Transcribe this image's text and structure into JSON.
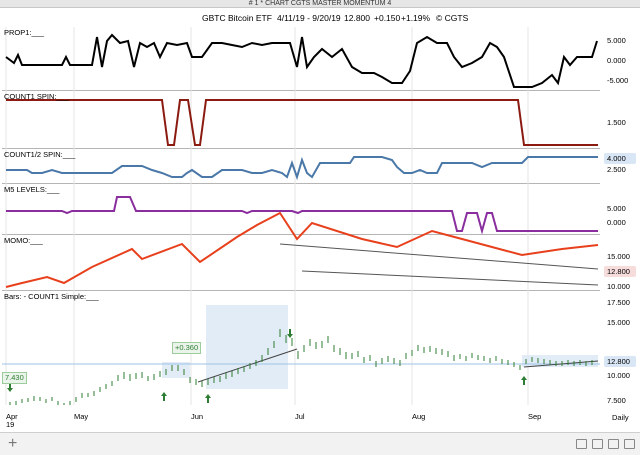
{
  "window": {
    "title": "# 1 * CHART CGTS MASTER MOMENTUM 4"
  },
  "header": {
    "symbol": "GBTC",
    "name": "Bitcoin ETF",
    "range": "4/11/19 - 9/20/19",
    "last": "12.800",
    "change": "+0.150",
    "pct": "+1.19%",
    "credit": "© CGTS"
  },
  "panels": {
    "prop1": {
      "label": "PROP1:___",
      "scale": [
        "5.000",
        "0.000",
        "-5.000"
      ]
    },
    "count1": {
      "label": "COUNT1 SPIN:___",
      "scale": [
        "1.500"
      ]
    },
    "count12": {
      "label": "COUNT1/2 SPIN:___",
      "value": "4.000",
      "scale": [
        "2.500"
      ]
    },
    "m5": {
      "label": "M5 LEVELS:___",
      "scale": [
        "5.000",
        "0.000"
      ]
    },
    "momo": {
      "label": "MOMO:___",
      "value": "12.800",
      "scale": [
        "15.000",
        "10.000"
      ]
    },
    "bars": {
      "label": "Bars: - COUNT1 Simple:___",
      "value": "12.800",
      "scale": [
        "17.500",
        "15.000",
        "10.000",
        "7.500"
      ]
    }
  },
  "annotations": {
    "left_price": "7.430",
    "mid_price": "+0.360"
  },
  "xaxis": {
    "labels": [
      "Apr",
      "May",
      "Jun",
      "Jul",
      "Aug",
      "Sep"
    ],
    "sub": "19"
  },
  "toolbar": {
    "period": "Daily"
  },
  "colors": {
    "prop1": "#000000",
    "count1": "#8b1a10",
    "count12": "#4a78a8",
    "m5": "#8a2d9e",
    "momo": "#e8401c",
    "up": "#2e7d32",
    "trend": "#555555",
    "highlight": "#dbe7f5"
  }
}
